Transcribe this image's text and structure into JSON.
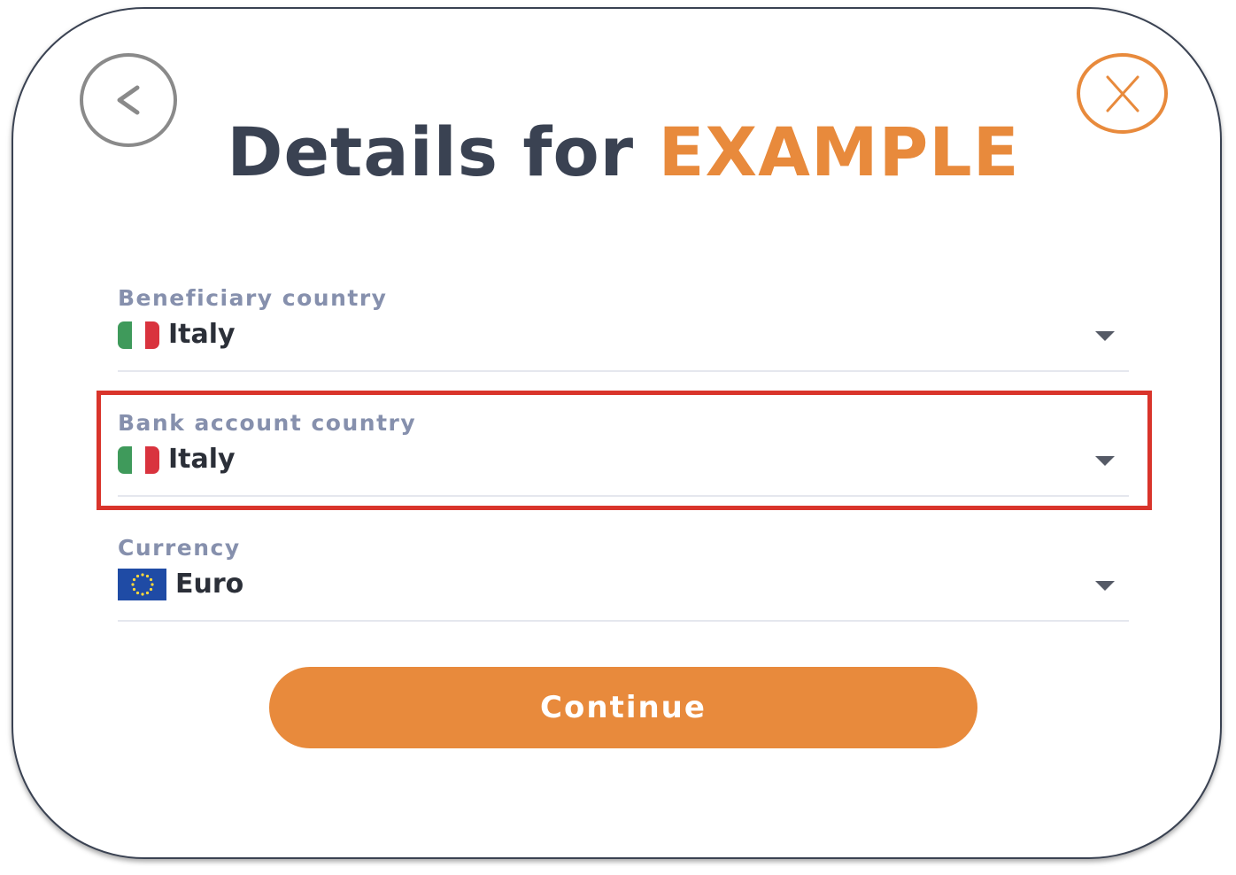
{
  "dialog": {
    "title_prefix": "Details for ",
    "title_highlight": "EXAMPLE",
    "back_label": "<",
    "close_label": "X"
  },
  "fields": [
    {
      "label": "Beneficiary country",
      "value": "Italy",
      "flag": "flag-italy"
    },
    {
      "label": "Bank account country",
      "value": "Italy",
      "flag": "flag-italy"
    },
    {
      "label": "Currency",
      "value": "Euro",
      "flag": "flag-eu"
    }
  ],
  "continue_label": "Continue",
  "colors": {
    "accent": "#e88a3c",
    "title": "#3a4252",
    "label": "#8690ad",
    "value": "#2b2f38",
    "highlight_box": "#d9342b",
    "back_circle": "#8a8a8a"
  },
  "icons": {
    "back": "back-arrow-icon",
    "close": "close-icon",
    "dropdown": "chevron-down-icon"
  }
}
